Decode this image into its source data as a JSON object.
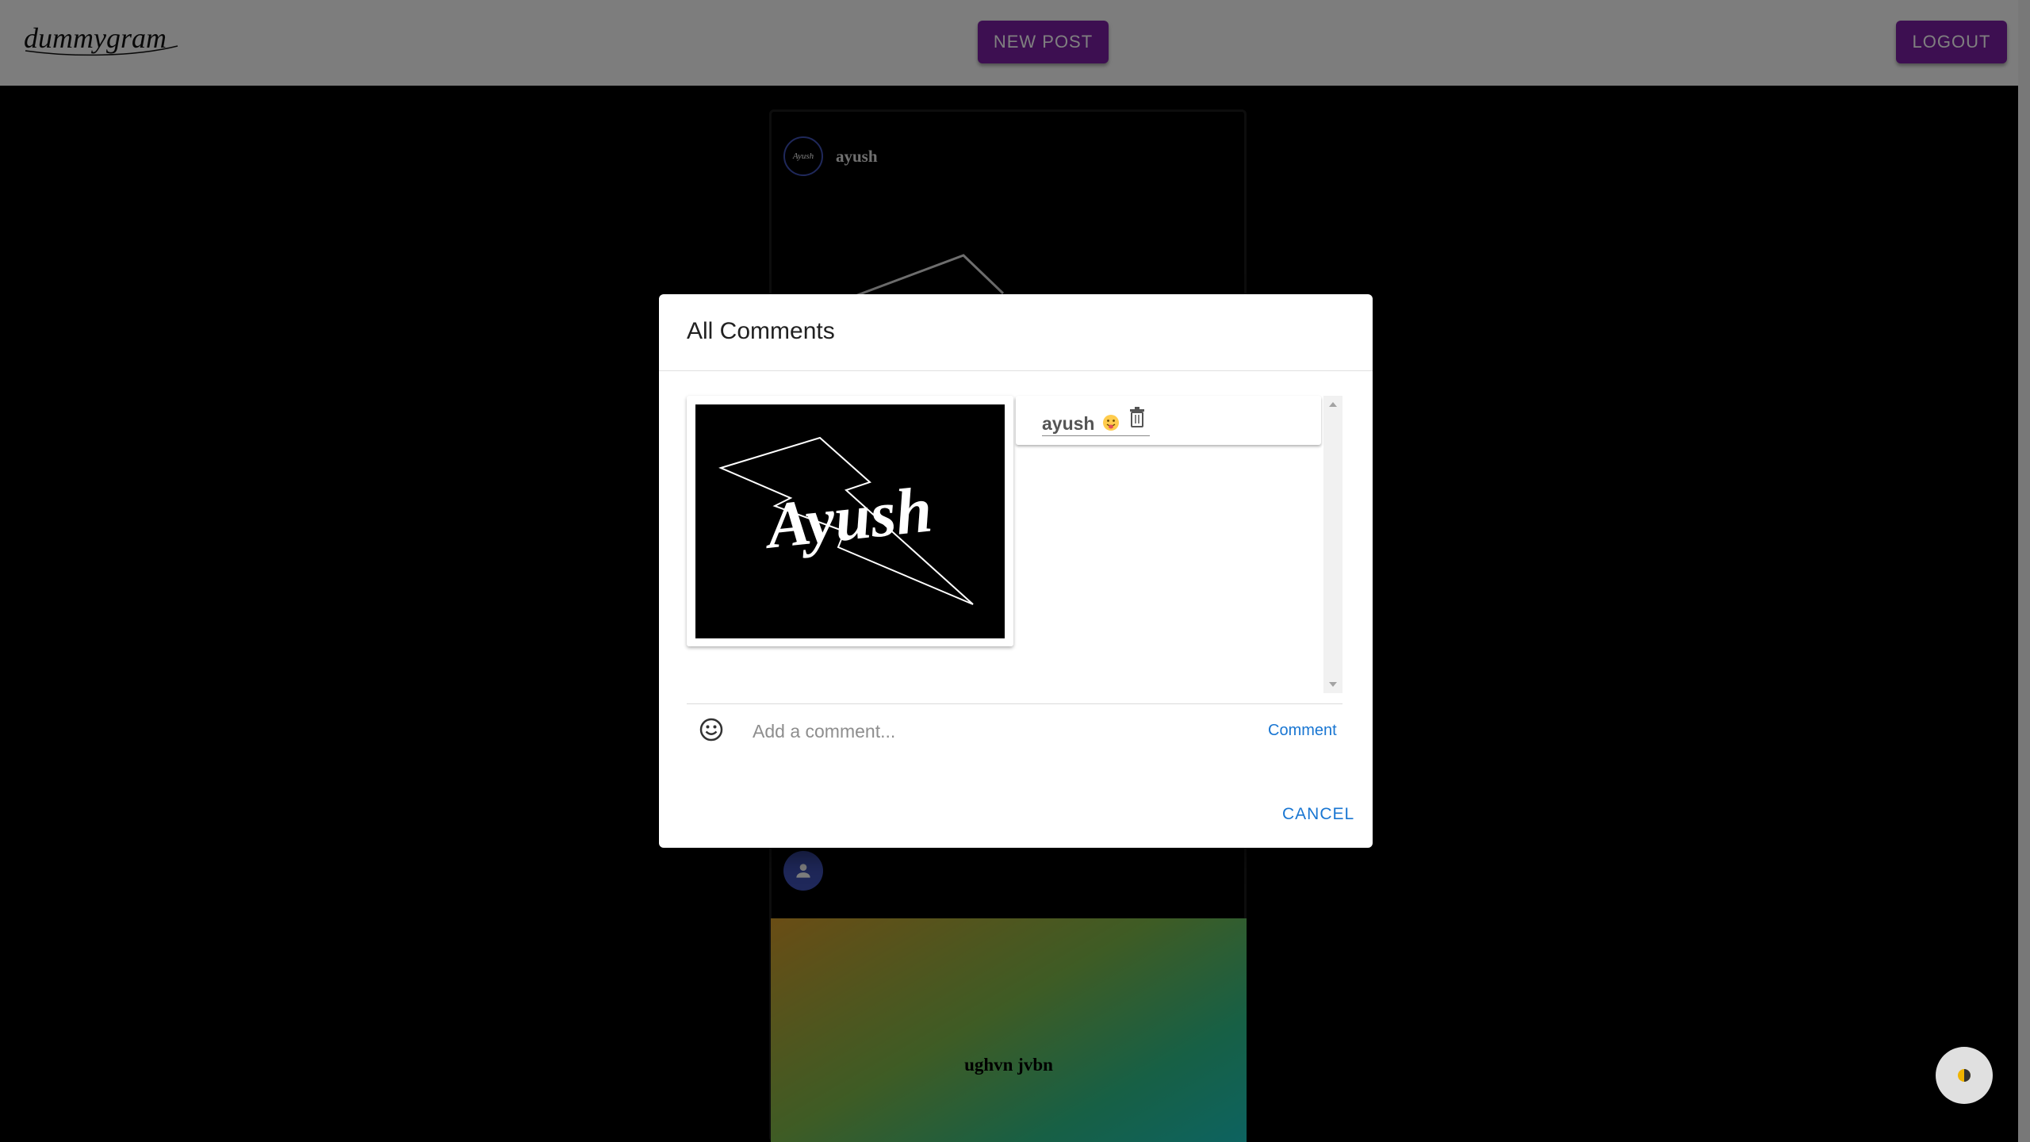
{
  "header": {
    "logo_text": "dummygram",
    "new_post_label": "NEW POST",
    "logout_label": "LOGOUT"
  },
  "feed": {
    "post1": {
      "username": "ayush",
      "avatar_text": "Ayush"
    },
    "post2": {
      "caption": "ughvn jvbn"
    }
  },
  "dialog": {
    "title": "All Comments",
    "image_text": "Ayush",
    "comments": [
      {
        "username": "ayush",
        "emoji": "😛"
      }
    ],
    "input_placeholder": "Add a comment...",
    "post_label": "Comment",
    "cancel_label": "CANCEL"
  },
  "colors": {
    "accent": "#7b1fa2",
    "link": "#1976d2",
    "avatar": "#3f51b5"
  },
  "icons": [
    "smiley-icon",
    "trash-icon",
    "person-icon",
    "theme-toggle-icon"
  ]
}
